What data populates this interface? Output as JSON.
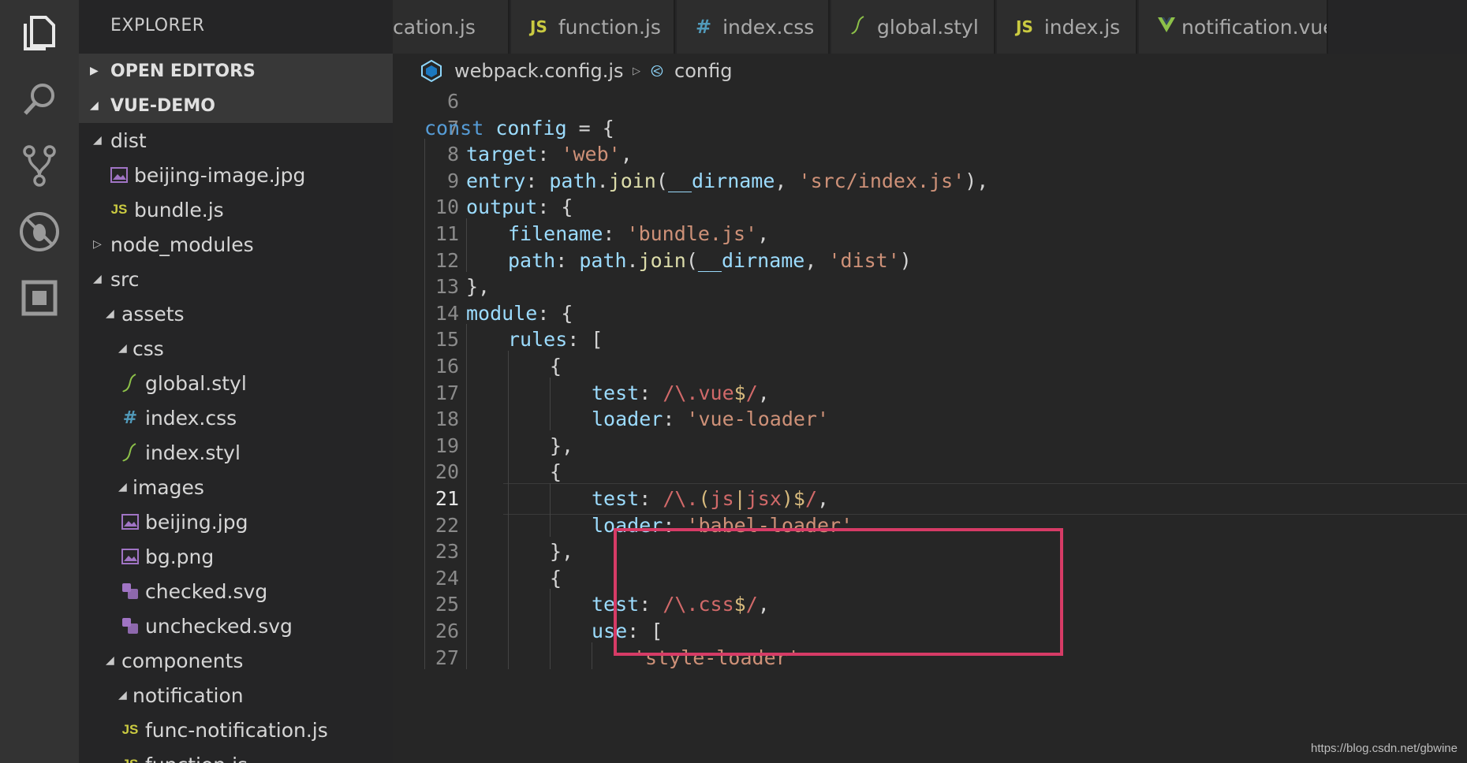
{
  "sidebar": {
    "title": "EXPLORER",
    "open_editors": "OPEN EDITORS",
    "project": "VUE-DEMO",
    "tree": [
      {
        "label": "dist",
        "twisty": "open",
        "icon": "",
        "depth": 0
      },
      {
        "label": "beijing-image.jpg",
        "twisty": "",
        "icon": "image-file-icon",
        "depth": 1
      },
      {
        "label": "bundle.js",
        "twisty": "",
        "icon": "js-file-icon",
        "depth": 1
      },
      {
        "label": "node_modules",
        "twisty": "closed",
        "icon": "",
        "depth": 0
      },
      {
        "label": "src",
        "twisty": "open",
        "icon": "",
        "depth": 0
      },
      {
        "label": "assets",
        "twisty": "open",
        "icon": "",
        "depth": 1
      },
      {
        "label": "css",
        "twisty": "open",
        "icon": "",
        "depth": 2
      },
      {
        "label": "global.styl",
        "twisty": "",
        "icon": "stylus-file-icon",
        "depth": 3
      },
      {
        "label": "index.css",
        "twisty": "",
        "icon": "css-file-icon",
        "depth": 3
      },
      {
        "label": "index.styl",
        "twisty": "",
        "icon": "stylus-file-icon",
        "depth": 3
      },
      {
        "label": "images",
        "twisty": "open",
        "icon": "",
        "depth": 2
      },
      {
        "label": "beijing.jpg",
        "twisty": "",
        "icon": "image-file-icon",
        "depth": 3
      },
      {
        "label": "bg.png",
        "twisty": "",
        "icon": "image-file-icon",
        "depth": 3
      },
      {
        "label": "checked.svg",
        "twisty": "",
        "icon": "svg-file-icon",
        "depth": 3
      },
      {
        "label": "unchecked.svg",
        "twisty": "",
        "icon": "svg-file-icon",
        "depth": 3
      },
      {
        "label": "components",
        "twisty": "open",
        "icon": "",
        "depth": 1
      },
      {
        "label": "notification",
        "twisty": "open",
        "icon": "",
        "depth": 2
      },
      {
        "label": "func-notification.js",
        "twisty": "",
        "icon": "js-file-icon",
        "depth": 3
      },
      {
        "label": "function.js",
        "twisty": "",
        "icon": "js-file-icon",
        "depth": 3
      }
    ]
  },
  "tabs": [
    {
      "label": "cation.js",
      "icon": "",
      "icon_text": ""
    },
    {
      "label": "function.js",
      "icon": "js-file-icon",
      "icon_text": "JS"
    },
    {
      "label": "index.css",
      "icon": "css-file-icon",
      "icon_text": "#"
    },
    {
      "label": "global.styl",
      "icon": "stylus-file-icon",
      "icon_text": ""
    },
    {
      "label": "index.js",
      "icon": "js-file-icon",
      "icon_text": "JS"
    },
    {
      "label": "notification.vue",
      "icon": "vue-file-icon",
      "icon_text": ""
    }
  ],
  "breadcrumb": {
    "file": "webpack.config.js",
    "symbol": "config"
  },
  "editor": {
    "active_line": 21,
    "lines": [
      {
        "n": "6",
        "indent": 0,
        "tokens": []
      },
      {
        "n": "7",
        "indent": 0,
        "tokens": [
          [
            "kw",
            "const "
          ],
          [
            "var",
            "config"
          ],
          [
            "pl",
            " = {"
          ]
        ]
      },
      {
        "n": "8",
        "indent": 1,
        "tokens": [
          [
            "prop",
            "target"
          ],
          [
            "pl",
            ": "
          ],
          [
            "str",
            "'web'"
          ],
          [
            "pl",
            ","
          ]
        ]
      },
      {
        "n": "9",
        "indent": 1,
        "tokens": [
          [
            "prop",
            "entry"
          ],
          [
            "pl",
            ": "
          ],
          [
            "var",
            "path"
          ],
          [
            "pl",
            "."
          ],
          [
            "fn",
            "join"
          ],
          [
            "pl",
            "("
          ],
          [
            "var",
            "__dirname"
          ],
          [
            "pl",
            ", "
          ],
          [
            "str",
            "'src/index.js'"
          ],
          [
            "pl",
            "),"
          ]
        ]
      },
      {
        "n": "10",
        "indent": 1,
        "tokens": [
          [
            "prop",
            "output"
          ],
          [
            "pl",
            ": {"
          ]
        ]
      },
      {
        "n": "11",
        "indent": 2,
        "tokens": [
          [
            "prop",
            "filename"
          ],
          [
            "pl",
            ": "
          ],
          [
            "str",
            "'bundle.js'"
          ],
          [
            "pl",
            ","
          ]
        ]
      },
      {
        "n": "12",
        "indent": 2,
        "tokens": [
          [
            "prop",
            "path"
          ],
          [
            "pl",
            ": "
          ],
          [
            "var",
            "path"
          ],
          [
            "pl",
            "."
          ],
          [
            "fn",
            "join"
          ],
          [
            "pl",
            "("
          ],
          [
            "var",
            "__dirname"
          ],
          [
            "pl",
            ", "
          ],
          [
            "str",
            "'dist'"
          ],
          [
            "pl",
            ")"
          ]
        ]
      },
      {
        "n": "13",
        "indent": 1,
        "tokens": [
          [
            "pl",
            "},"
          ]
        ]
      },
      {
        "n": "14",
        "indent": 1,
        "tokens": [
          [
            "prop",
            "module"
          ],
          [
            "pl",
            ": {"
          ]
        ]
      },
      {
        "n": "15",
        "indent": 2,
        "tokens": [
          [
            "prop",
            "rules"
          ],
          [
            "pl",
            ": ["
          ]
        ]
      },
      {
        "n": "16",
        "indent": 3,
        "tokens": [
          [
            "pl",
            "{"
          ]
        ]
      },
      {
        "n": "17",
        "indent": 4,
        "tokens": [
          [
            "prop",
            "test"
          ],
          [
            "pl",
            ": "
          ],
          [
            "re",
            "/\\.vue"
          ],
          [
            "reop",
            "$"
          ],
          [
            "re",
            "/"
          ],
          [
            "pl",
            ","
          ]
        ]
      },
      {
        "n": "18",
        "indent": 4,
        "tokens": [
          [
            "prop",
            "loader"
          ],
          [
            "pl",
            ": "
          ],
          [
            "str",
            "'vue-loader'"
          ]
        ]
      },
      {
        "n": "19",
        "indent": 3,
        "tokens": [
          [
            "pl",
            "},"
          ]
        ]
      },
      {
        "n": "20",
        "indent": 3,
        "tokens": [
          [
            "pl",
            "{"
          ]
        ]
      },
      {
        "n": "21",
        "indent": 4,
        "tokens": [
          [
            "prop",
            "test"
          ],
          [
            "pl",
            ": "
          ],
          [
            "re",
            "/\\."
          ],
          [
            "reop",
            "("
          ],
          [
            "re",
            "js"
          ],
          [
            "reop",
            "|"
          ],
          [
            "re",
            "jsx"
          ],
          [
            "reop",
            ")$"
          ],
          [
            "re",
            "/"
          ],
          [
            "pl",
            ","
          ]
        ]
      },
      {
        "n": "22",
        "indent": 4,
        "tokens": [
          [
            "prop",
            "loader"
          ],
          [
            "pl",
            ": "
          ],
          [
            "str",
            "'babel-loader'"
          ]
        ]
      },
      {
        "n": "23",
        "indent": 3,
        "tokens": [
          [
            "pl",
            "},"
          ]
        ]
      },
      {
        "n": "24",
        "indent": 3,
        "tokens": [
          [
            "pl",
            "{"
          ]
        ]
      },
      {
        "n": "25",
        "indent": 4,
        "tokens": [
          [
            "prop",
            "test"
          ],
          [
            "pl",
            ": "
          ],
          [
            "re",
            "/\\.css"
          ],
          [
            "reop",
            "$"
          ],
          [
            "re",
            "/"
          ],
          [
            "pl",
            ","
          ]
        ]
      },
      {
        "n": "26",
        "indent": 4,
        "tokens": [
          [
            "prop",
            "use"
          ],
          [
            "pl",
            ": ["
          ]
        ]
      },
      {
        "n": "27",
        "indent": 5,
        "tokens": [
          [
            "str",
            "'style-loader'"
          ]
        ]
      }
    ]
  },
  "watermark": "https://blog.csdn.net/gbwine",
  "colors": {
    "highlight_box": "#d63b66",
    "js_icon": "#cbcb41",
    "css_icon": "#519aba",
    "stylus_icon": "#8dc149",
    "vue_icon": "#8dc149",
    "image_icon": "#a074c4"
  }
}
